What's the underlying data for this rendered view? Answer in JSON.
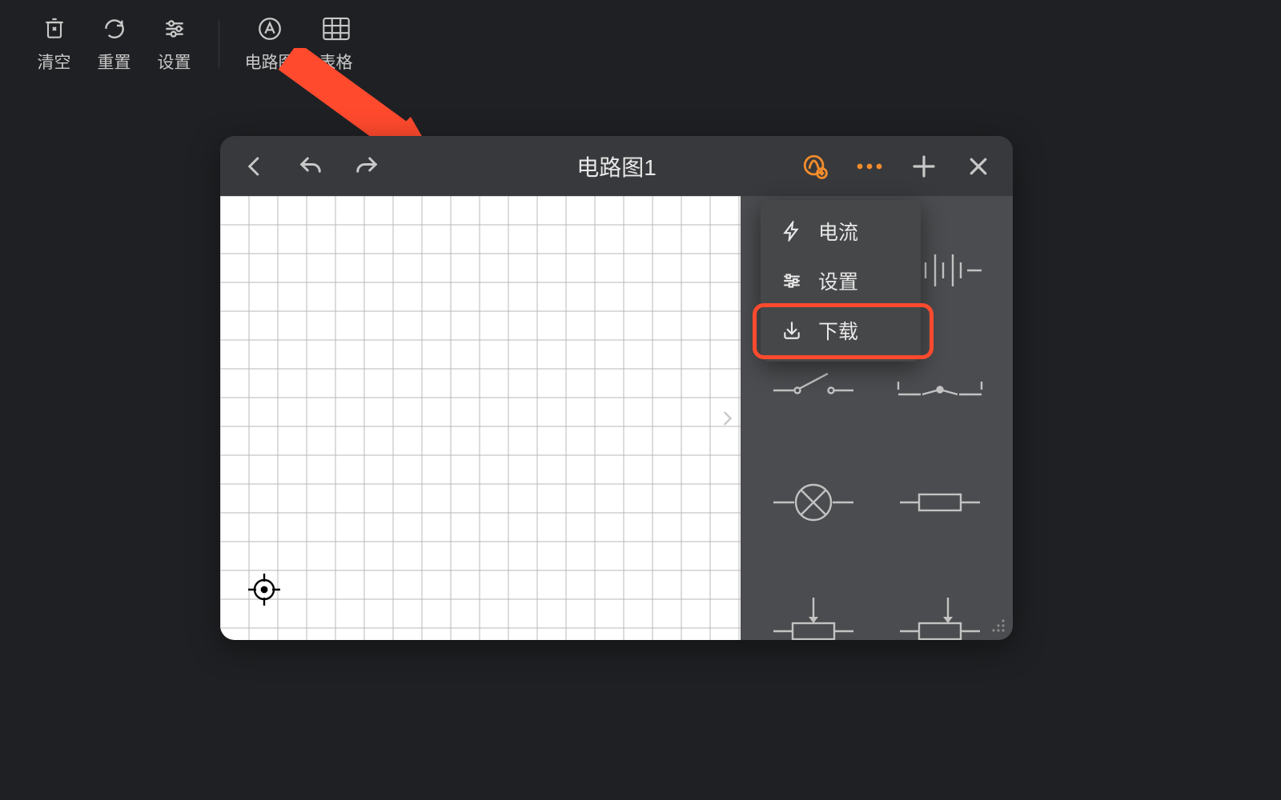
{
  "toolbar": {
    "clear": "清空",
    "reset": "重置",
    "settings": "设置",
    "circuit": "电路图",
    "table": "表格"
  },
  "window": {
    "title": "电路图1"
  },
  "menu": {
    "current": "电流",
    "settings": "设置",
    "download": "下载"
  },
  "palette_icons": [
    "power-source-icon",
    "battery-cells-icon",
    "switch-open-icon",
    "switch-knife-icon",
    "lamp-bulb-icon",
    "resistor-icon",
    "variable-resistor-a-icon",
    "variable-resistor-b-icon"
  ],
  "colors": {
    "accent": "#f28c2b",
    "annotation": "#ff4a2e"
  }
}
